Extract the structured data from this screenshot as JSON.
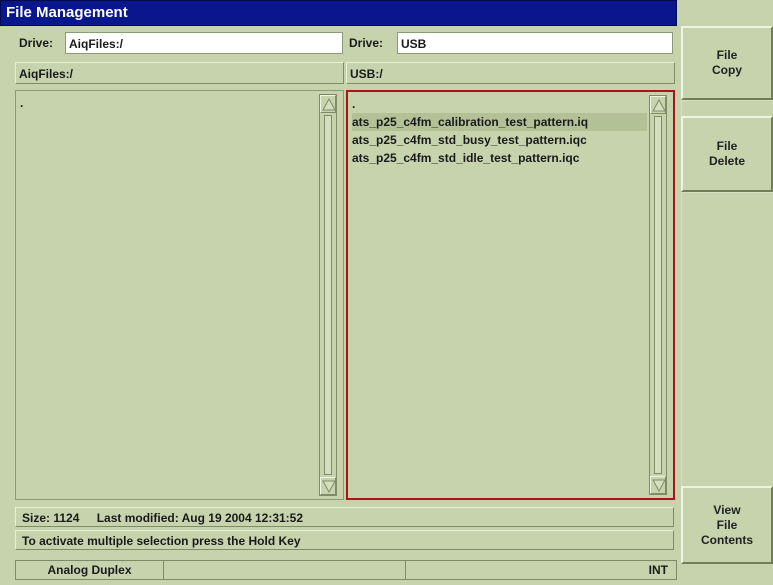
{
  "window": {
    "title": "File Management"
  },
  "left_pane": {
    "drive_label": "Drive:",
    "drive_value": "AiqFiles:/",
    "path": "AiqFiles:/",
    "items": [
      "."
    ]
  },
  "right_pane": {
    "drive_label": "Drive:",
    "drive_value": "USB",
    "path": "USB:/",
    "items": [
      ".",
      "ats_p25_c4fm_calibration_test_pattern.iq",
      "ats_p25_c4fm_std_busy_test_pattern.iqc",
      "ats_p25_c4fm_std_idle_test_pattern.iqc"
    ],
    "highlighted_index": 1
  },
  "info": {
    "size": "Size: 1124",
    "modified": "Last modified: Aug 19 2004 12:31:52",
    "hint": "To activate multiple selection press the Hold Key"
  },
  "status": {
    "mode": "Analog Duplex",
    "cell2": "",
    "cell3": "",
    "source": "INT"
  },
  "softkeys": {
    "file_copy": "File\nCopy",
    "file_delete": "File\nDelete",
    "view_file_contents": "View\nFile\nContents"
  },
  "colors": {
    "background": "#c6d3ad",
    "title_bar": "#0a168c",
    "selected_border": "#a5161b"
  },
  "icons": {
    "scroll_up": "triangle-up-icon",
    "scroll_down": "triangle-down-icon"
  }
}
